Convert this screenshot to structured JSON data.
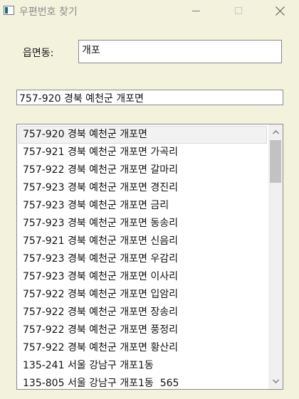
{
  "window": {
    "title": "우편번호 찾기"
  },
  "search": {
    "label": "읍면동:",
    "value": "개포"
  },
  "result": {
    "value": "757-920 경북 예천군 개포면"
  },
  "list": {
    "selected_index": 0,
    "items": [
      "757-920 경북 예천군 개포면",
      "757-921 경북 예천군 개포면 가곡리",
      "757-922 경북 예천군 개포면 갈마리",
      "757-923 경북 예천군 개포면 경진리",
      "757-923 경북 예천군 개포면 금리",
      "757-923 경북 예천군 개포면 동송리",
      "757-921 경북 예천군 개포면 신음리",
      "757-923 경북 예천군 개포면 우감리",
      "757-923 경북 예천군 개포면 이사리",
      "757-922 경북 예천군 개포면 입암리",
      "757-922 경북 예천군 개포면 장송리",
      "757-922 경북 예천군 개포면 풍정리",
      "757-922 경북 예천군 개포면 황산리",
      "135-241 서울 강남구 개포1동",
      "135-805 서울 강남구 개포1동  565"
    ]
  }
}
